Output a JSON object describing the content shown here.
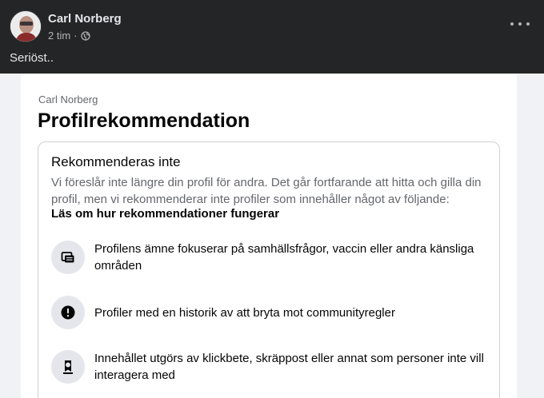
{
  "post": {
    "author": "Carl Norberg",
    "time": "2 tim",
    "separator": "·",
    "text": "Seriöst..",
    "icons": {
      "more": "more-horizontal-icon",
      "audience": "globe-icon"
    }
  },
  "panel": {
    "owner": "Carl Norberg",
    "title": "Profilrekommendation",
    "card": {
      "heading": "Rekommenderas inte",
      "description": "Vi föreslår inte längre din profil för andra. Det går fortfarande att hitta och gilla din profil, men vi rekommenderar inte profiler som innehåller något av följande:",
      "link": "Läs om hur rekommendationer fungerar",
      "reasons": [
        {
          "icon": "chat-bubbles-icon",
          "text": "Profilens ämne fokuserar på samhällsfrågor, vaccin eller andra känsliga områden"
        },
        {
          "icon": "exclamation-circle-icon",
          "text": "Profiler med en historik av att bryta mot communityregler"
        },
        {
          "icon": "badge-ribbon-icon",
          "text": "Innehållet utgörs av klickbete, skräppost eller annat som personer inte vill interagera med"
        }
      ]
    }
  },
  "colors": {
    "header_bg": "#242526",
    "header_text": "#e4e6eb",
    "muted": "#b0b3b8",
    "panel_text": "#050505",
    "secondary_text": "#65676b"
  }
}
